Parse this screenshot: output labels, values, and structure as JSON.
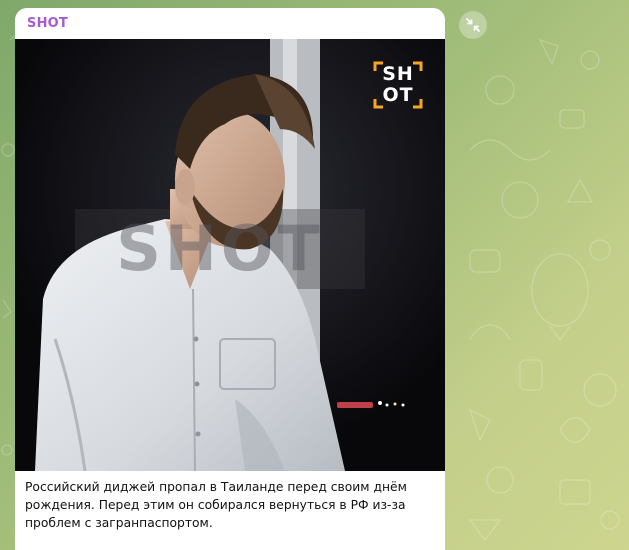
{
  "channel": {
    "name": "SHOT"
  },
  "post": {
    "logo_text": {
      "top": "SH",
      "bottom": "OT"
    },
    "watermark": "SHOT",
    "caption_lines": [
      "Российский диджей пропал в Таиланде перед своим днём",
      "рождения. Перед этим он собирался вернуться в РФ из-за",
      "проблем с загранпаспортом."
    ]
  },
  "colors": {
    "channel_name": "#a85bd0",
    "logo_accent": "#f6a623",
    "chat_background": "#a3be7a"
  },
  "icons": {
    "expand": "collapse-arrows-icon"
  }
}
